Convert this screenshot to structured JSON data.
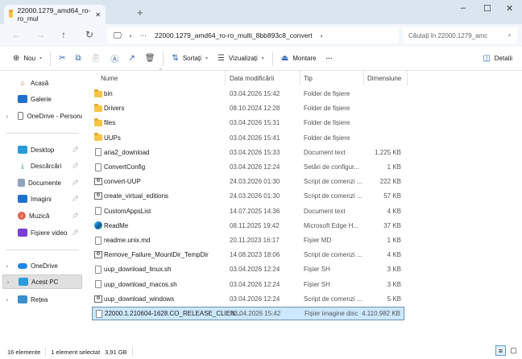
{
  "window": {
    "tab_title": "22000.1279_amd64_ro-ro_mul",
    "new_tab": "+",
    "minimize": "–",
    "maximize": "☐",
    "close": "✕"
  },
  "nav": {
    "back": "←",
    "forward": "→",
    "up": "↑",
    "refresh": "↻",
    "address_path": "22000.1279_amd64_ro-ro_multi_8bb893c8_convert",
    "more": "···",
    "search_placeholder": "Căutați în 22000.1279_amc"
  },
  "toolbar": {
    "new": "Nou",
    "sort": "Sortați",
    "view": "Vizualizați",
    "mount": "Montare",
    "more": "···",
    "details": "Detalii"
  },
  "sidebar": {
    "top": [
      {
        "label": "Acasă",
        "icon": "home-icon"
      },
      {
        "label": "Galerie",
        "icon": "gallery-icon"
      },
      {
        "label": "OneDrive - Persona",
        "icon": "file-icon"
      }
    ],
    "pinned": [
      {
        "label": "Desktop",
        "icon": "desktop-icon"
      },
      {
        "label": "Descărcări",
        "icon": "download-icon"
      },
      {
        "label": "Documente",
        "icon": "documents-icon"
      },
      {
        "label": "Imagini",
        "icon": "pictures-icon"
      },
      {
        "label": "Muzică",
        "icon": "music-icon"
      },
      {
        "label": "Fișiere video",
        "icon": "video-icon"
      }
    ],
    "bottom": [
      {
        "label": "OneDrive",
        "icon": "cloud-icon"
      },
      {
        "label": "Acest PC",
        "icon": "pc-icon"
      },
      {
        "label": "Rețea",
        "icon": "network-icon"
      }
    ]
  },
  "columns": {
    "name": "Nume",
    "date": "Data modificării",
    "type": "Tip",
    "size": "Dimensiune"
  },
  "files": [
    {
      "name": "bin",
      "date": "03.04.2026 15:42",
      "type": "Folder de fișiere",
      "size": "",
      "icon": "folder"
    },
    {
      "name": "Drivers",
      "date": "08.10.2024 12:28",
      "type": "Folder de fișiere",
      "size": "",
      "icon": "folder"
    },
    {
      "name": "files",
      "date": "03.04.2026 15:31",
      "type": "Folder de fișiere",
      "size": "",
      "icon": "folder"
    },
    {
      "name": "UUPs",
      "date": "03.04.2026 15:41",
      "type": "Folder de fișiere",
      "size": "",
      "icon": "folder"
    },
    {
      "name": "aria2_download",
      "date": "03.04.2026 15:33",
      "type": "Document text",
      "size": "1.225 KB",
      "icon": "file"
    },
    {
      "name": "ConvertConfig",
      "date": "03.04.2026 12:24",
      "type": "Setări de configur...",
      "size": "1 KB",
      "icon": "file"
    },
    {
      "name": "convert-UUP",
      "date": "24.03.2026 01:30",
      "type": "Script de comenzi ...",
      "size": "222 KB",
      "icon": "script"
    },
    {
      "name": "create_virtual_editions",
      "date": "24.03.2026 01:30",
      "type": "Script de comenzi ...",
      "size": "57 KB",
      "icon": "script"
    },
    {
      "name": "CustomAppsList",
      "date": "14.07.2025 14:36",
      "type": "Document text",
      "size": "4 KB",
      "icon": "file"
    },
    {
      "name": "ReadMe",
      "date": "08.11.2025 19:42",
      "type": "Microsoft Edge H...",
      "size": "37 KB",
      "icon": "edge"
    },
    {
      "name": "readme.unix.md",
      "date": "20.11.2023 16:17",
      "type": "Fișier MD",
      "size": "1 KB",
      "icon": "file"
    },
    {
      "name": "Remove_Failure_MountDir_TempDir",
      "date": "14.08.2023 18:06",
      "type": "Script de comenzi ...",
      "size": "4 KB",
      "icon": "script"
    },
    {
      "name": "uup_download_linux.sh",
      "date": "03.04.2026 12:24",
      "type": "Fișier SH",
      "size": "3 KB",
      "icon": "file"
    },
    {
      "name": "uup_download_macos.sh",
      "date": "03.04.2026 12:24",
      "type": "Fișier SH",
      "size": "3 KB",
      "icon": "file"
    },
    {
      "name": "uup_download_windows",
      "date": "03.04.2026 12:24",
      "type": "Script de comenzi ...",
      "size": "5 KB",
      "icon": "script"
    },
    {
      "name": "22000.1.210604-1628.CO_RELEASE_CLIEN...",
      "date": "03.04.2026 15:42",
      "type": "Fișier imagine disc",
      "size": "4.110.982 KB",
      "icon": "file",
      "selected": true
    }
  ],
  "status": {
    "count": "16 elemente",
    "selected": "1 element selectat",
    "selected_size": "3,91 GB"
  }
}
